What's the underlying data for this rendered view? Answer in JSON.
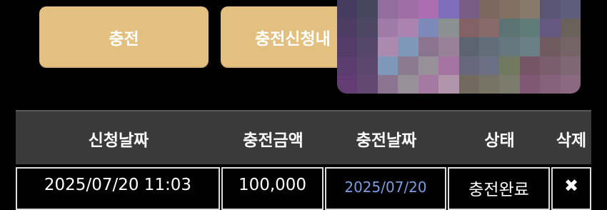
{
  "buttons": {
    "charge_label": "충전",
    "history_label": "충전신청내"
  },
  "table": {
    "headers": [
      "신청날짜",
      "충전금액",
      "충전날짜",
      "상태",
      "삭제"
    ],
    "rows": [
      {
        "request_date": "2025/07/20 11:03",
        "amount": "100,000",
        "charge_date": "2025/07/20",
        "status": "충전완료",
        "delete_icon": "✖"
      }
    ]
  },
  "colors": {
    "button_bg": "#e3c07f",
    "header_bg": "#3a3a3a",
    "charge_date_text": "#7d9be0",
    "page_bg": "#000000"
  },
  "icons": {
    "delete": "close-x-icon"
  }
}
